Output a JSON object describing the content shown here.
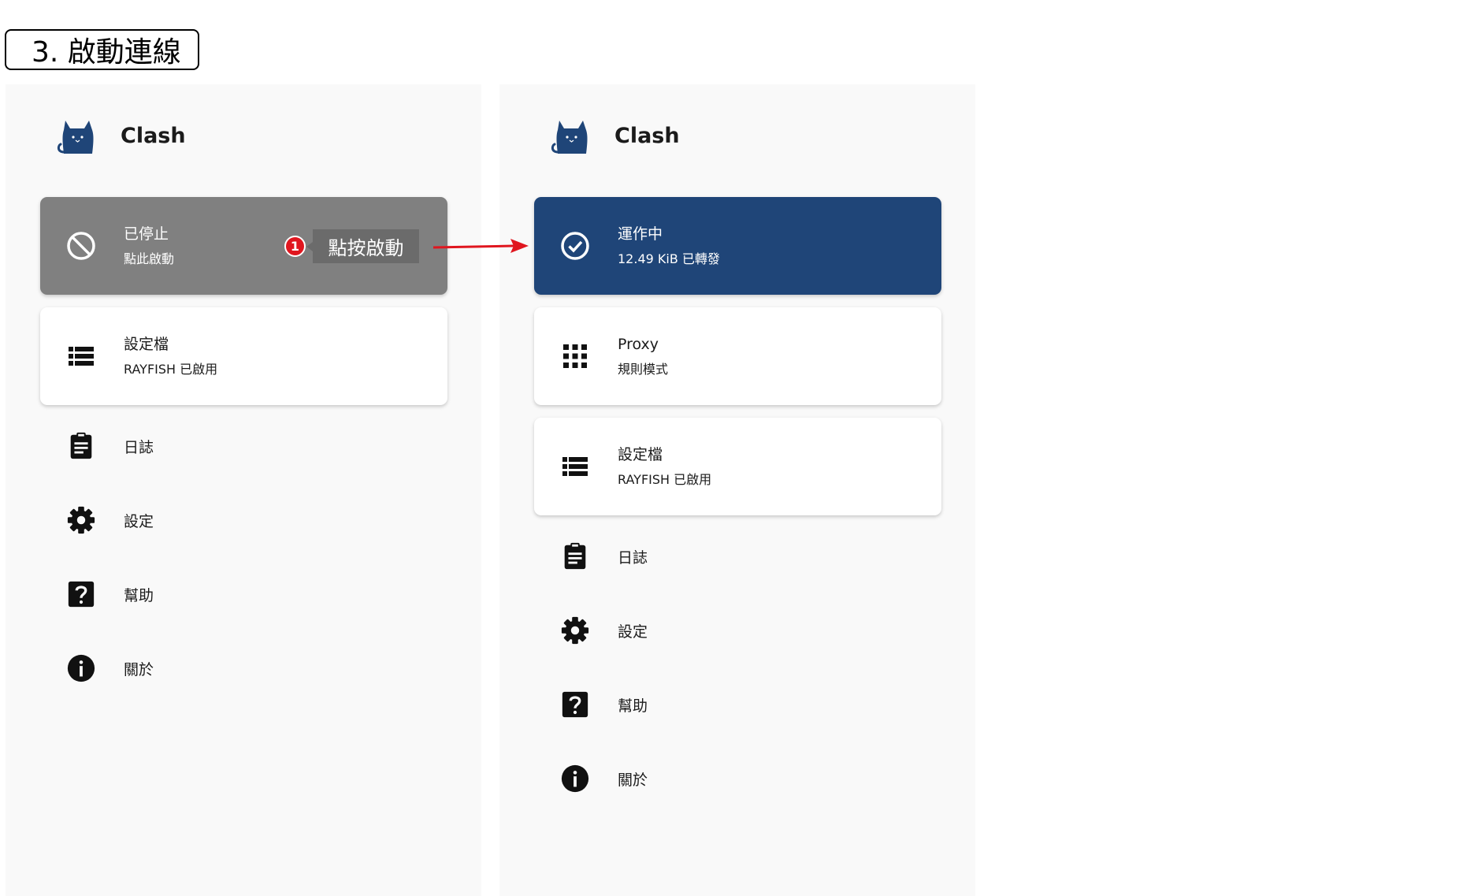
{
  "step_title": "3. 啟動連線",
  "colors": {
    "stopped_card": "#808080",
    "running_card": "#1f4578",
    "badge": "#e0161f",
    "arrow": "#e0161f",
    "logo": "#1f4578"
  },
  "left_panel": {
    "app_title": "Clash",
    "status_card": {
      "icon": "block-icon",
      "title": "已停止",
      "subtitle": "點此啟動"
    },
    "profile_card": {
      "icon": "list-icon",
      "title": "設定檔",
      "subtitle": "RAYFISH 已啟用"
    },
    "nav": [
      {
        "icon": "clipboard-icon",
        "label": "日誌"
      },
      {
        "icon": "gear-icon",
        "label": "設定"
      },
      {
        "icon": "help-icon",
        "label": "幫助"
      },
      {
        "icon": "info-icon",
        "label": "關於"
      }
    ]
  },
  "annotation": {
    "badge": "1",
    "tooltip": "點按啟動"
  },
  "right_panel": {
    "app_title": "Clash",
    "status_card": {
      "icon": "check-circle-icon",
      "title": "運作中",
      "subtitle": "12.49 KiB 已轉發"
    },
    "proxy_card": {
      "icon": "apps-grid-icon",
      "title": "Proxy",
      "subtitle": "規則模式"
    },
    "profile_card": {
      "icon": "list-icon",
      "title": "設定檔",
      "subtitle": "RAYFISH 已啟用"
    },
    "nav": [
      {
        "icon": "clipboard-icon",
        "label": "日誌"
      },
      {
        "icon": "gear-icon",
        "label": "設定"
      },
      {
        "icon": "help-icon",
        "label": "幫助"
      },
      {
        "icon": "info-icon",
        "label": "關於"
      }
    ]
  }
}
